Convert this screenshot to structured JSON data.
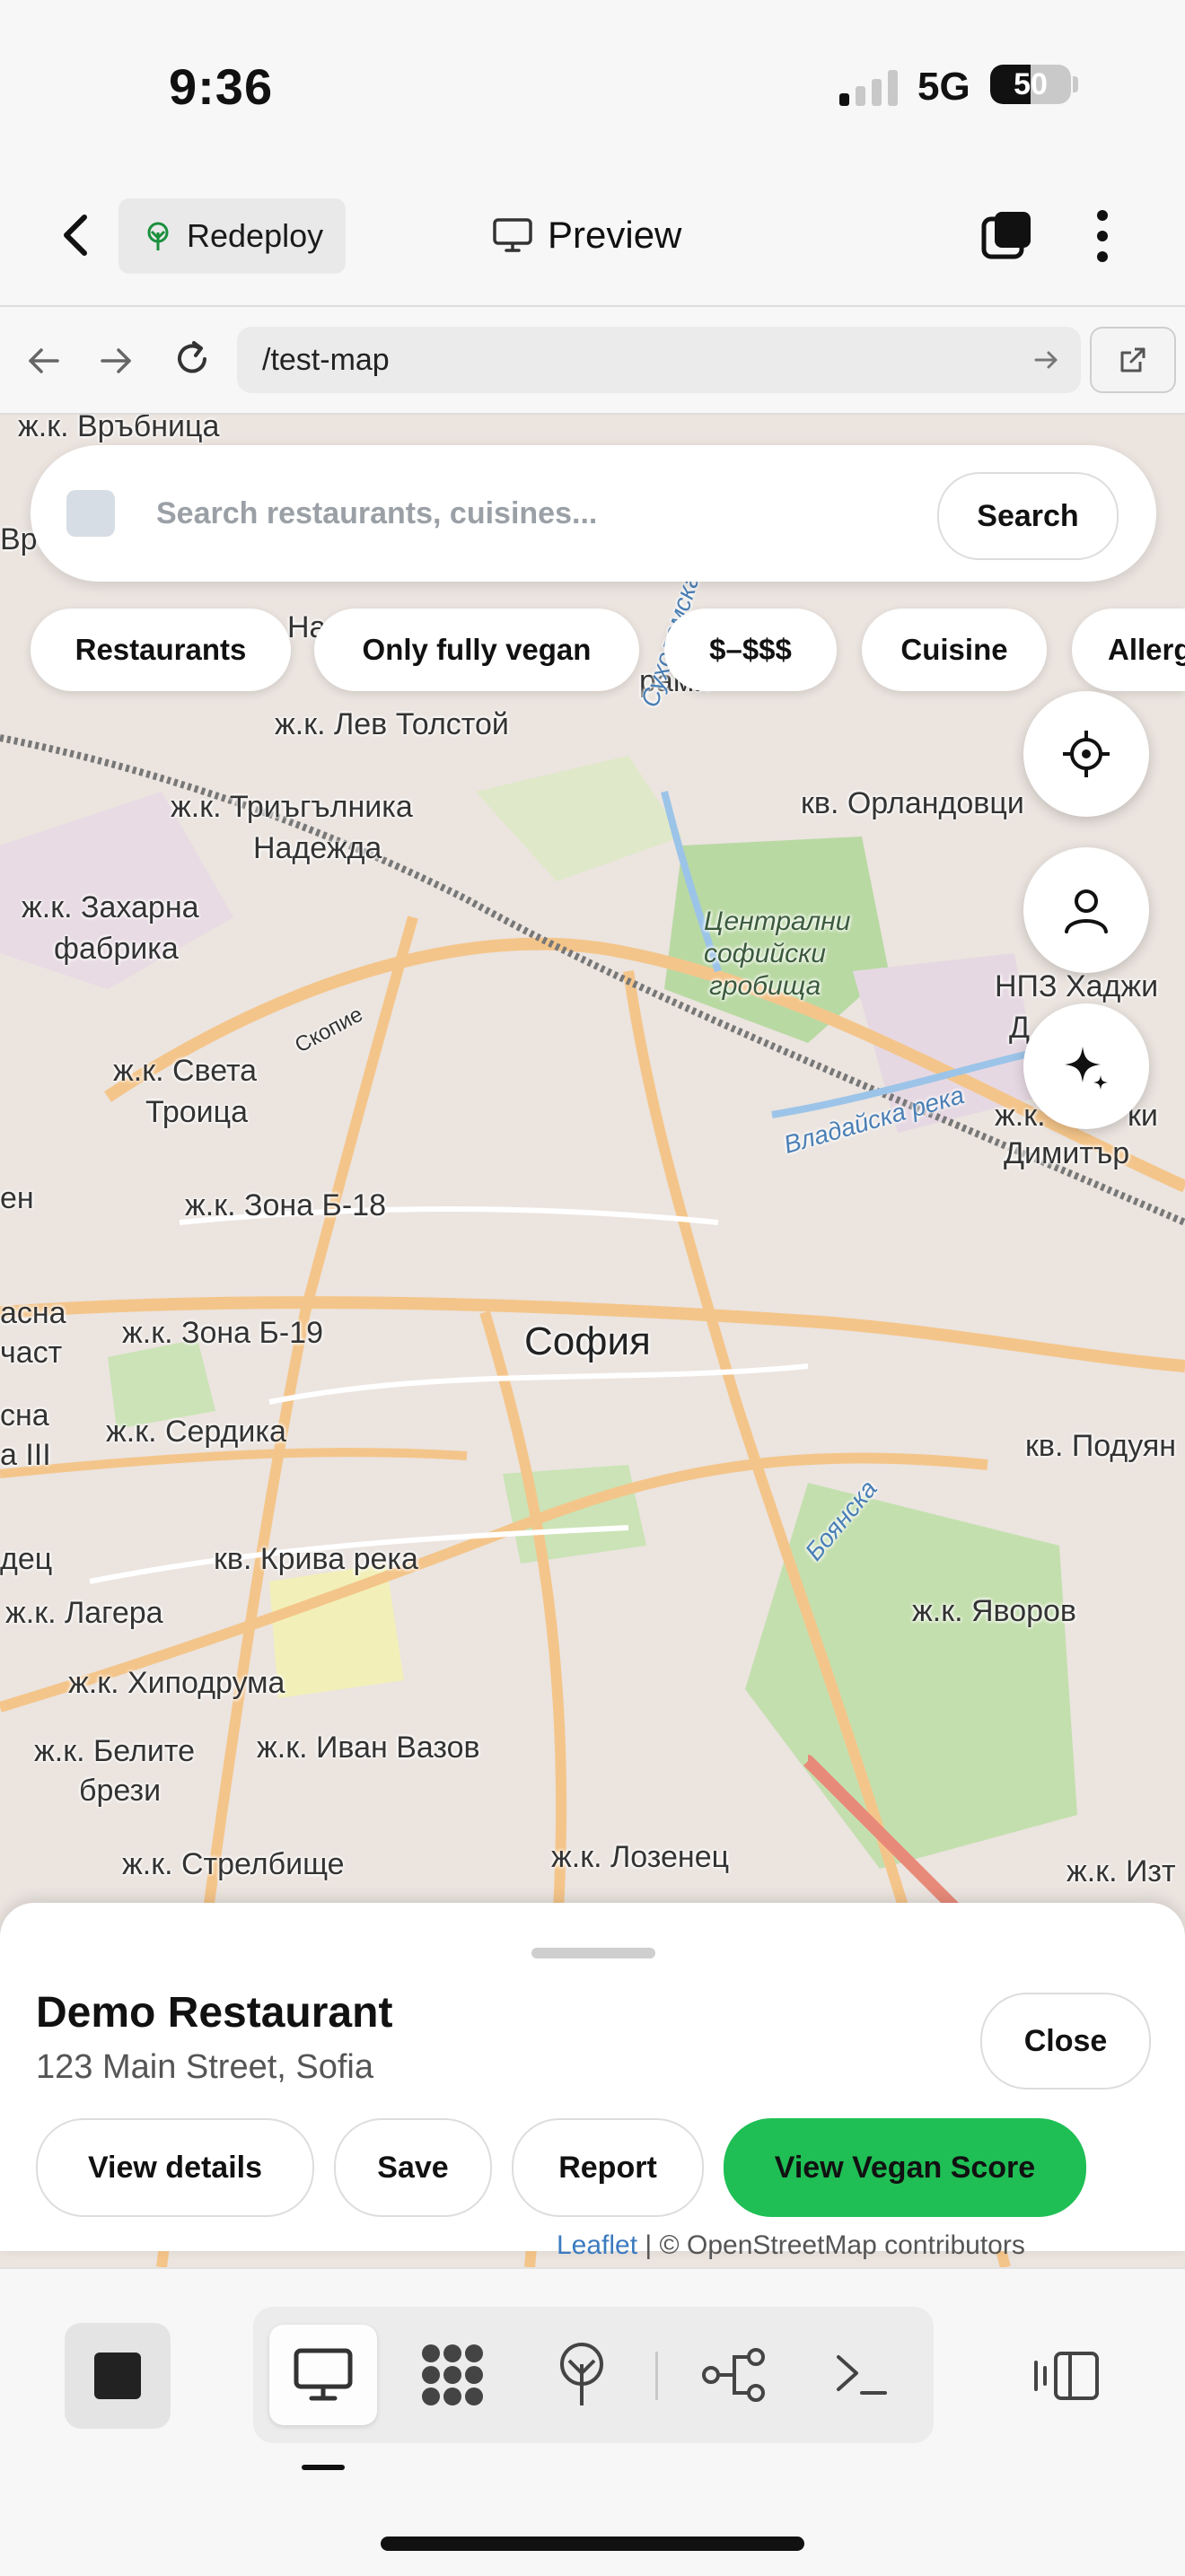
{
  "status_bar": {
    "time": "9:36",
    "network": "5G",
    "battery": "50",
    "battery_level": 0.5,
    "signal_bars_on": 1,
    "signal_bars_total": 4
  },
  "header": {
    "redeploy_label": "Redeploy",
    "preview_label": "Preview"
  },
  "browser": {
    "url": "/test-map"
  },
  "search": {
    "placeholder": "Search restaurants, cuisines...",
    "button_label": "Search"
  },
  "filters": [
    "Restaurants",
    "Only fully vegan",
    "$–$$$",
    "Cuisine",
    "Allergens"
  ],
  "map": {
    "labels": [
      "ж.к. Връбница",
      "На",
      "рами",
      "ж.к. Лев Толстой",
      "ж.к. Триъгълника",
      "Надежда",
      "кв. Орландовци",
      "ж.к. Захарна",
      "фабрика",
      "Централни",
      "софийски",
      "гробища",
      "ж.к. Света",
      "Троица",
      "НПЗ Хаджи",
      "Д",
      "ж.к.",
      "ки",
      "Димитър",
      "ж.к. Зона Б-18",
      "ж.к. Зона Б-19",
      "София",
      "ж.к. Сердика",
      "кв. Подуян",
      "кв. Крива река",
      "ж.к. Лагера",
      "ж.к. Яворов",
      "ж.к. Хиподрума",
      "ж.к. Белите",
      "брези",
      "ж.к. Иван Вазов",
      "ж.к. Стрелбище",
      "ж.к. Лозенец",
      "ж.к. Изт",
      "Сухоломска",
      "Владайска река",
      "Скопие",
      "Вр",
      "ен",
      "асна",
      "част",
      "сна",
      "а III",
      "дец",
      "Боянска"
    ],
    "attribution": {
      "leaflet": "Leaflet",
      "osm": "| © OpenStreetMap contributors"
    }
  },
  "place": {
    "name": "Demo Restaurant",
    "address": "123 Main Street, Sofia",
    "close_label": "Close",
    "actions": [
      "View details",
      "Save",
      "Report",
      "View Vegan Score"
    ]
  },
  "colors": {
    "accent_green": "#1fbf55",
    "chip_bg": "#ffffff",
    "road": "#f4c58a"
  }
}
